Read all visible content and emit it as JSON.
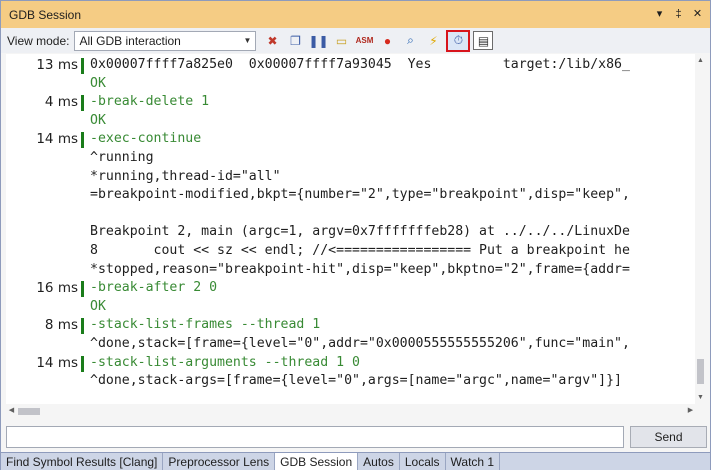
{
  "window": {
    "title": "GDB Session",
    "buttons": [
      "▾",
      "‡",
      "✕"
    ]
  },
  "toolbar": {
    "view_mode_label": "View mode:",
    "view_mode_value": "All GDB interaction",
    "tools": [
      {
        "name": "clear-all-icon",
        "glyph": "✖",
        "color": "#c0392b"
      },
      {
        "name": "copy-icon",
        "glyph": "❐",
        "color": "#3b5ba5"
      },
      {
        "name": "pause-icon",
        "glyph": "❚❚",
        "color": "#3b5ba5"
      },
      {
        "name": "folder-icon",
        "glyph": "▭",
        "color": "#c9a227"
      },
      {
        "name": "asm-icon",
        "glyph": "ASM",
        "color": "#b0291e"
      },
      {
        "name": "breakpoint-icon",
        "glyph": "●",
        "color": "#d62a1e"
      },
      {
        "name": "search-icon",
        "glyph": "⌕",
        "color": "#1f5fb0"
      },
      {
        "name": "lightning-icon",
        "glyph": "⚡",
        "color": "#e0a800"
      },
      {
        "name": "stopwatch-icon",
        "glyph": "⏱",
        "color": "#3b5ba5"
      },
      {
        "name": "window-icon",
        "glyph": "▤",
        "color": "#333333"
      }
    ]
  },
  "log": [
    {
      "time": "13 ms",
      "kind": "out",
      "text": "0x00007ffff7a825e0  0x00007ffff7a93045  Yes         target:/lib/x86_"
    },
    {
      "time": "",
      "kind": "cmd",
      "text": "OK"
    },
    {
      "time": "4 ms",
      "kind": "cmd",
      "text": "-break-delete 1"
    },
    {
      "time": "",
      "kind": "cmd",
      "text": "OK"
    },
    {
      "time": "14 ms",
      "kind": "cmd",
      "text": "-exec-continue"
    },
    {
      "time": "",
      "kind": "out",
      "text": "^running"
    },
    {
      "time": "",
      "kind": "out",
      "text": "*running,thread-id=\"all\""
    },
    {
      "time": "",
      "kind": "out",
      "text": "=breakpoint-modified,bkpt={number=\"2\",type=\"breakpoint\",disp=\"keep\","
    },
    {
      "time": "",
      "kind": "out",
      "text": ""
    },
    {
      "time": "",
      "kind": "out",
      "text": "Breakpoint 2, main (argc=1, argv=0x7fffffffeb28) at ../../../LinuxDe"
    },
    {
      "time": "",
      "kind": "out",
      "text": "8       cout << sz << endl; //<================= Put a breakpoint he"
    },
    {
      "time": "",
      "kind": "out",
      "text": "*stopped,reason=\"breakpoint-hit\",disp=\"keep\",bkptno=\"2\",frame={addr="
    },
    {
      "time": "16 ms",
      "kind": "cmd",
      "text": "-break-after 2 0"
    },
    {
      "time": "",
      "kind": "cmd",
      "text": "OK"
    },
    {
      "time": "8 ms",
      "kind": "cmd",
      "text": "-stack-list-frames --thread 1"
    },
    {
      "time": "",
      "kind": "out",
      "text": "^done,stack=[frame={level=\"0\",addr=\"0x0000555555555206\",func=\"main\","
    },
    {
      "time": "14 ms",
      "kind": "cmd",
      "text": "-stack-list-arguments --thread 1 0"
    },
    {
      "time": "",
      "kind": "out",
      "text": "^done,stack-args=[frame={level=\"0\",args=[name=\"argc\",name=\"argv\"]}]"
    }
  ],
  "input": {
    "value": "",
    "send_label": "Send"
  },
  "tabs": [
    {
      "label": "Find Symbol Results [Clang]",
      "active": false
    },
    {
      "label": "Preprocessor Lens",
      "active": false
    },
    {
      "label": "GDB Session",
      "active": true
    },
    {
      "label": "Autos",
      "active": false
    },
    {
      "label": "Locals",
      "active": false
    },
    {
      "label": "Watch 1",
      "active": false
    }
  ]
}
